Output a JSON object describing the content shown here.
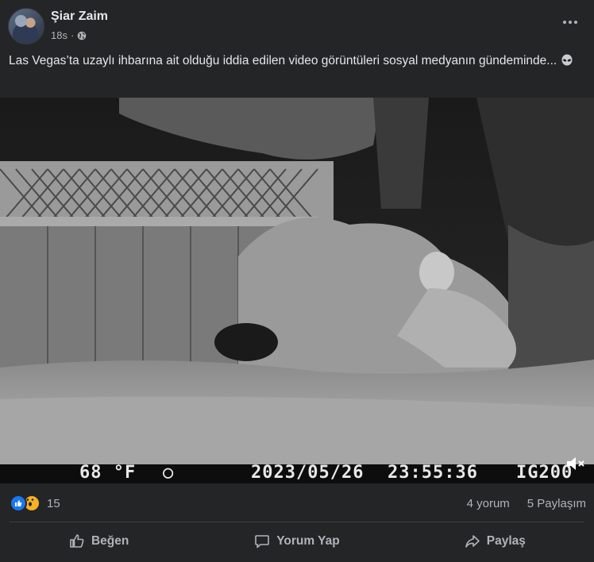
{
  "post": {
    "author": "Şiar Zaim",
    "time": "18s",
    "privacy_icon": "globe-icon",
    "text": "Las Vegas’ta uzaylı ihbarına ait olduğu iddia edilen video görüntüleri sosyal medyanın gündeminde...",
    "emoji_icon": "alien-icon"
  },
  "video": {
    "temperature": "68 °F",
    "date": "2023/05/26",
    "time": "23:55:36",
    "camera_model": "IG200"
  },
  "stats": {
    "reactions": [
      "like-icon",
      "wow-icon"
    ],
    "reaction_count": "15",
    "comments": "4 yorum",
    "shares": "5 Paylaşım"
  },
  "actions": {
    "like": "Beğen",
    "comment": "Yorum Yap",
    "share": "Paylaş"
  },
  "colors": {
    "background": "#242526",
    "primary_text": "#e4e6eb",
    "secondary_text": "#b0b3b8",
    "like_blue": "#1877f2"
  }
}
